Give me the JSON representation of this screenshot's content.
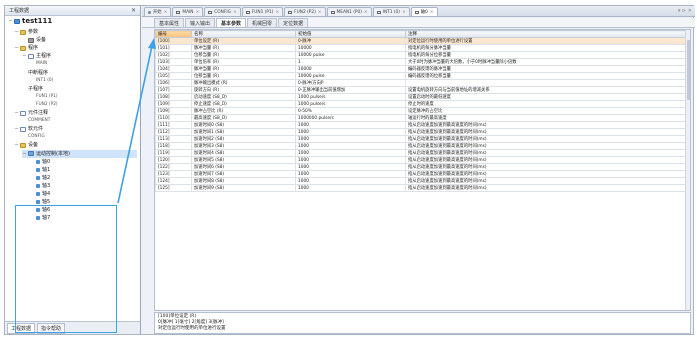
{
  "left_panel": {
    "title": "工程数据",
    "pin": "✕",
    "tree": [
      {
        "label": "test111",
        "level": 0,
        "icon": "root",
        "expander": "−"
      },
      {
        "label": "参数",
        "level": 1,
        "icon": "folder",
        "expander": "−"
      },
      {
        "label": "设备",
        "level": 2,
        "icon": "cog",
        "expander": ""
      },
      {
        "label": "程序",
        "level": 1,
        "icon": "folder",
        "expander": "−"
      },
      {
        "label": "主程序",
        "level": 2,
        "icon": "doc",
        "expander": "−"
      },
      {
        "label": "MAIN",
        "level": 3,
        "icon": "",
        "expander": "",
        "small": true
      },
      {
        "label": "中断程序",
        "level": 2,
        "icon": "",
        "expander": ""
      },
      {
        "label": "INT1 (0)",
        "level": 3,
        "icon": "",
        "expander": "",
        "small": true
      },
      {
        "label": "子程序",
        "level": 2,
        "icon": "",
        "expander": ""
      },
      {
        "label": "FUN1 (P1)",
        "level": 3,
        "icon": "",
        "expander": "",
        "small": true
      },
      {
        "label": "FUN2 (P2)",
        "level": 3,
        "icon": "",
        "expander": "",
        "small": true
      },
      {
        "label": "元件注释",
        "level": 1,
        "icon": "doc",
        "expander": "−"
      },
      {
        "label": "COMMENT",
        "level": 2,
        "icon": "",
        "expander": "",
        "small": true
      },
      {
        "label": "软元件",
        "level": 1,
        "icon": "doc",
        "expander": "−"
      },
      {
        "label": "CONFIG",
        "level": 2,
        "icon": "",
        "expander": "",
        "small": true
      },
      {
        "label": "设备",
        "level": 1,
        "icon": "folder",
        "expander": "−"
      },
      {
        "label": "运动控制(本地)",
        "level": 2,
        "icon": "blue",
        "expander": "−",
        "selected": true
      },
      {
        "label": "轴0",
        "level": 3,
        "icon": "axis",
        "expander": ""
      },
      {
        "label": "轴1",
        "level": 3,
        "icon": "axis",
        "expander": ""
      },
      {
        "label": "轴2",
        "level": 3,
        "icon": "axis",
        "expander": ""
      },
      {
        "label": "轴3",
        "level": 3,
        "icon": "axis",
        "expander": ""
      },
      {
        "label": "轴4",
        "level": 3,
        "icon": "axis",
        "expander": ""
      },
      {
        "label": "轴5",
        "level": 3,
        "icon": "axis",
        "expander": ""
      },
      {
        "label": "轴6",
        "level": 3,
        "icon": "axis",
        "expander": ""
      },
      {
        "label": "轴7",
        "level": 3,
        "icon": "axis",
        "expander": ""
      }
    ],
    "bottom_tabs": [
      "工程数据",
      "指令帮助"
    ]
  },
  "doc_tabs": [
    {
      "label": "开始",
      "icon": "dot"
    },
    {
      "label": "MAIN",
      "icon": "sq"
    },
    {
      "label": "CONFIG",
      "icon": "sq"
    },
    {
      "label": "FUN1 (P1)",
      "icon": "sq"
    },
    {
      "label": "FUN2 (P2)",
      "icon": "sq"
    },
    {
      "label": "MEAN1 (P0)",
      "icon": "sq"
    },
    {
      "label": "INT1 (0)",
      "icon": "sq"
    },
    {
      "label": "轴0",
      "icon": "sq",
      "active": true
    }
  ],
  "doc_tabs_more": "▾ ⊳ ✕",
  "sub_tabs": [
    {
      "label": "基本属性"
    },
    {
      "label": "输入输出"
    },
    {
      "label": "基本参数",
      "active": true
    },
    {
      "label": "机械回零"
    },
    {
      "label": "定位数据"
    }
  ],
  "table": {
    "columns": [
      "编号",
      "名称",
      "初始值",
      "注释"
    ],
    "rows": [
      [
        "[100]",
        "单位设定 (R)",
        "0-脉冲",
        "对定位运行时使用的单位进行设置",
        "sel"
      ],
      [
        "[101]",
        "脉冲当量 (R)",
        "10000",
        "指电机的每分脉冲当量",
        ""
      ],
      [
        "[102]",
        "位移当量 (R)",
        "10000 pulse",
        "指电机的每分位移当量",
        ""
      ],
      [
        "[103]",
        "单位倍率 (R)",
        "1",
        "大于0时为脉冲当量的大倍数，小于0时脉冲当量除小倍数",
        ""
      ],
      [
        "[104]",
        "脉冲当量 (R)",
        "10000",
        "编码器反馈的脉冲当量",
        ""
      ],
      [
        "[105]",
        "位移当量 (R)",
        "10000 pulse",
        "编码器反馈的位移当量",
        ""
      ],
      [
        "[106]",
        "脉冲输出模式 (R)",
        "0-脉冲/方向P",
        "",
        ""
      ],
      [
        "[107]",
        "旋转方向 (R)",
        "0-正脉冲输出当前值增加",
        "设置电机旋转方向与当前值地址的增减关系",
        ""
      ],
      [
        "[108]",
        "启动速度 (S8_D)",
        "1000 pulse/s",
        "设置启动时的最低速度",
        ""
      ],
      [
        "[109]",
        "停止速度 (S8_D)",
        "1000 pulse/s",
        "停止时的速度",
        ""
      ],
      [
        "[109]",
        "脉冲占空比 (R)",
        "0-50%",
        "设定脉冲的占空比",
        ""
      ],
      [
        "[110]",
        "最高速度 (S8_D)",
        "1000000 pulse/s",
        "轴运行时的最高速度",
        ""
      ],
      [
        "[111]",
        "加速时间0 (S8)",
        "1000",
        "指从启动速度加速到最高速度的时间(ms)",
        ""
      ],
      [
        "[112]",
        "加速时间1 (S8)",
        "1000",
        "指从启动速度加速到最高速度的时间(ms)",
        ""
      ],
      [
        "[113]",
        "加速时间2 (S8)",
        "1000",
        "指从启动速度加速到最高速度的时间(ms)",
        ""
      ],
      [
        "[118]",
        "加速时间3 (S8)",
        "1000",
        "指从启动速度加速到最高速度的时间(ms)",
        ""
      ],
      [
        "[119]",
        "加速时间4 (S8)",
        "1000",
        "指从启动速度加速到最高速度的时间(ms)",
        ""
      ],
      [
        "[120]",
        "加速时间5 (S8)",
        "1000",
        "指从启动速度加速到最高速度的时间(ms)",
        ""
      ],
      [
        "[122]",
        "加速时间6 (S8)",
        "1000",
        "指从启动速度加速到最高速度的时间(ms)",
        ""
      ],
      [
        "[123]",
        "加速时间7 (S8)",
        "1000",
        "指从启动速度加速到最高速度的时间(ms)",
        ""
      ],
      [
        "[124]",
        "加速时间8 (S8)",
        "1000",
        "指从启动速度加速到最高速度的时间(ms)",
        ""
      ],
      [
        "[125]",
        "加速时间9 (S8)",
        "1000",
        "指从启动速度加速到最高速度的时间(ms)",
        ""
      ]
    ]
  },
  "description": {
    "line1": "[100]单位设定 (R)",
    "line2": "0[脉冲] 1[毫寸] 2[角度] 3[脉冲]",
    "line3": "对定位运行时使用的单位进行设置"
  },
  "colors": {
    "highlight": "#3da1ea",
    "selected_row": "#fbe7cf"
  }
}
